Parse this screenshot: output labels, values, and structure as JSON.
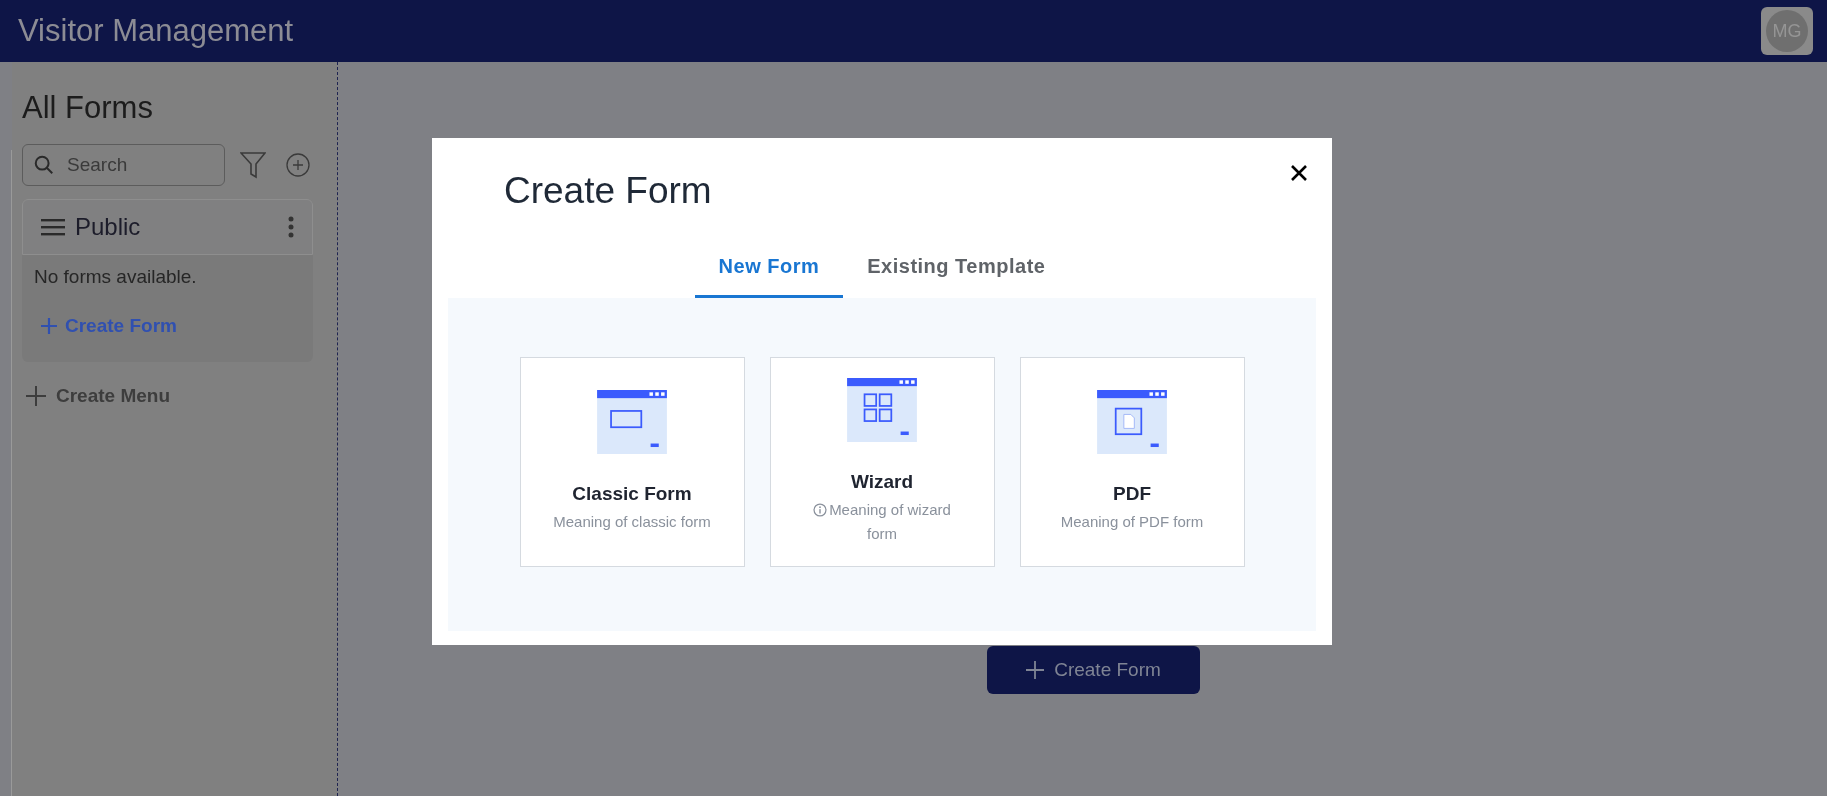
{
  "header": {
    "title": "Visitor Management",
    "avatar": "MG"
  },
  "sidebar": {
    "title": "All Forms",
    "search": {
      "placeholder": "Search"
    },
    "groups": [
      {
        "name": "Public",
        "empty_text": "No forms available.",
        "create_label": "Create Form"
      }
    ],
    "create_menu": "Create Menu"
  },
  "main": {
    "create_button": "Create Form"
  },
  "modal": {
    "title": "Create Form",
    "tabs": [
      {
        "label": "New Form",
        "selected": true
      },
      {
        "label": "Existing Template",
        "selected": false
      }
    ],
    "cards": [
      {
        "kind": "classic",
        "title": "Classic Form",
        "description": "Meaning of classic form",
        "info": false
      },
      {
        "kind": "wizard",
        "title": "Wizard",
        "description": "Meaning of wizard form",
        "info": true
      },
      {
        "kind": "pdf",
        "title": "PDF",
        "description": "Meaning of PDF form",
        "info": false
      }
    ]
  }
}
